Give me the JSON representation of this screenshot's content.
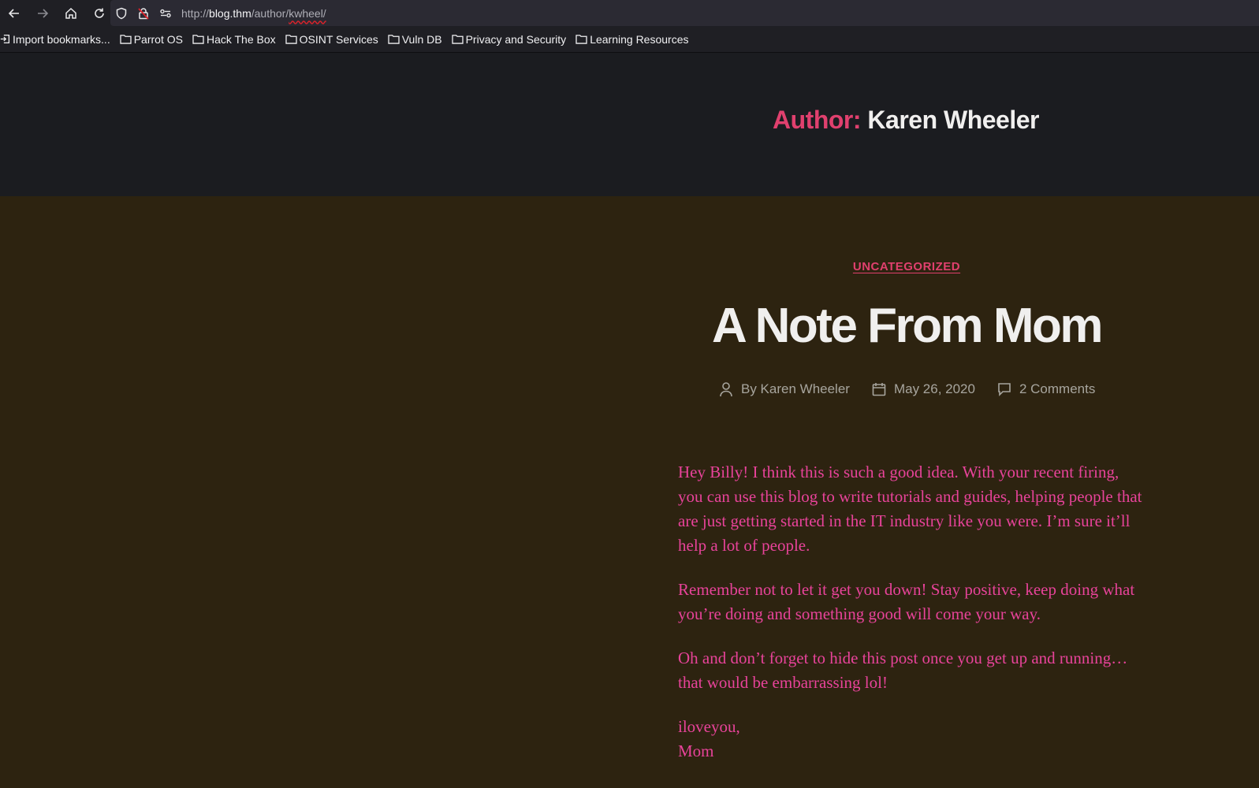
{
  "browser": {
    "url_scheme": "http://",
    "url_host": "blog.thm",
    "url_path_prefix": "/author/",
    "url_path_highlight": "kwheel/"
  },
  "bookmarks": [
    {
      "label": "Import bookmarks...",
      "icon": "import-icon"
    },
    {
      "label": "Parrot OS",
      "icon": "folder-icon"
    },
    {
      "label": "Hack The Box",
      "icon": "folder-icon"
    },
    {
      "label": "OSINT Services",
      "icon": "folder-icon"
    },
    {
      "label": "Vuln DB",
      "icon": "folder-icon"
    },
    {
      "label": "Privacy and Security",
      "icon": "folder-icon"
    },
    {
      "label": "Learning Resources",
      "icon": "folder-icon"
    }
  ],
  "archive": {
    "prefix": "Author:",
    "name": "Karen Wheeler"
  },
  "post": {
    "category": "UNCATEGORIZED",
    "title": "A Note From Mom",
    "author_label": "By Karen Wheeler",
    "date": "May 26, 2020",
    "comments": "2 Comments",
    "paragraphs": [
      "Hey Billy!  I think this is such a good idea.  With your recent firing, you can use this blog to write tutorials and guides, helping people that are just getting started in the IT industry like you were.  I’m sure it’ll help a lot of people.",
      "Remember not to let it get you down!  Stay positive, keep doing what you’re doing and something good will come your way.",
      "Oh and don’t forget to hide this post once you get up and running… that would be embarrassing lol!"
    ],
    "signoff_line1": "iloveyou,",
    "signoff_line2": "Mom"
  },
  "colors": {
    "accent": "#e0406e",
    "body_text": "#e8439a",
    "background": "#2d2310",
    "header_bg": "#1b1c20"
  }
}
